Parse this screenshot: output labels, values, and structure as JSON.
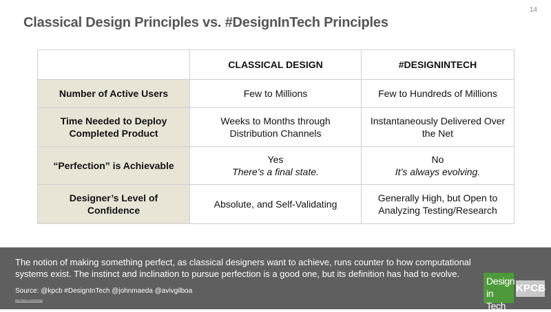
{
  "slide": {
    "page_number": "14",
    "title": "Classical Design Principles vs. #DesignInTech Principles"
  },
  "table": {
    "columns": [
      "CLASSICAL DESIGN",
      "#DESIGNINTECH"
    ],
    "rows": [
      {
        "label": "Number of Active Users",
        "classical": "Few to Millions",
        "designintech": "Few to Hundreds of Millions"
      },
      {
        "label": "Time Needed to Deploy Completed Product",
        "classical": "Weeks to Months through Distribution Channels",
        "designintech": "Instantaneously Delivered Over the Net"
      },
      {
        "label": "“Perfection” is Achievable",
        "classical": "Yes",
        "classical_note": "There’s a final state.",
        "designintech": "No",
        "designintech_note": "It’s always evolving."
      },
      {
        "label": "Designer’s Level of Confidence",
        "classical": "Absolute, and Self-Validating",
        "designintech": "Generally High, but Open to Analyzing Testing/Research"
      }
    ]
  },
  "footer": {
    "text": "The notion of making something perfect, as classical designers want to achieve, runs counter to how computational systems exist. The instinct and inclination to pursue perfection is a good one, but its definition has had to evolve.",
    "source": "Source: @kpcb #DesignInTech @johnmaeda @avivgilboa",
    "link": "http://kpcb.com/design"
  },
  "logos": {
    "design_in_tech_line1": "Design",
    "design_in_tech_line2": "in Tech",
    "kpcb": "KPCB"
  },
  "colors": {
    "row_header_bg": "#e9e5d6",
    "footer_bg": "#5f5f5f",
    "design_logo_green": "#4e9a3a",
    "kpcb_logo_gray": "#c9c9c9"
  }
}
